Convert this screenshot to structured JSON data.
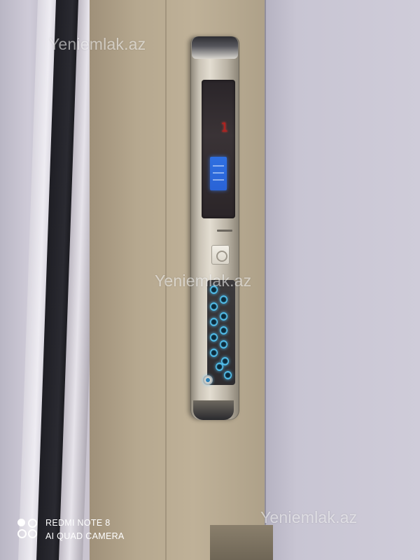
{
  "photo": {
    "subject": "elevator car operating panel",
    "colors": {
      "cabin_wall": "#bfb198",
      "panel_steel": "#e3ddd1",
      "button_glow": "#5fd3ff",
      "lcd_blue": "#2e6fe0",
      "floor_digit_red": "#b3201e"
    }
  },
  "watermarks": [
    "Yeniemlak.az",
    "Yeniemlak.az",
    "Yeniemlak.az"
  ],
  "camera_badge": {
    "line1": "REDMI NOTE 8",
    "line2": "AI QUAD CAMERA",
    "icon": "quad-camera-logo-icon"
  },
  "elevator_panel": {
    "floor_display": "1",
    "button_count": 12,
    "icons": [
      "lcd-display-icon",
      "card-reader-icon",
      "alarm-bell-icon"
    ]
  }
}
